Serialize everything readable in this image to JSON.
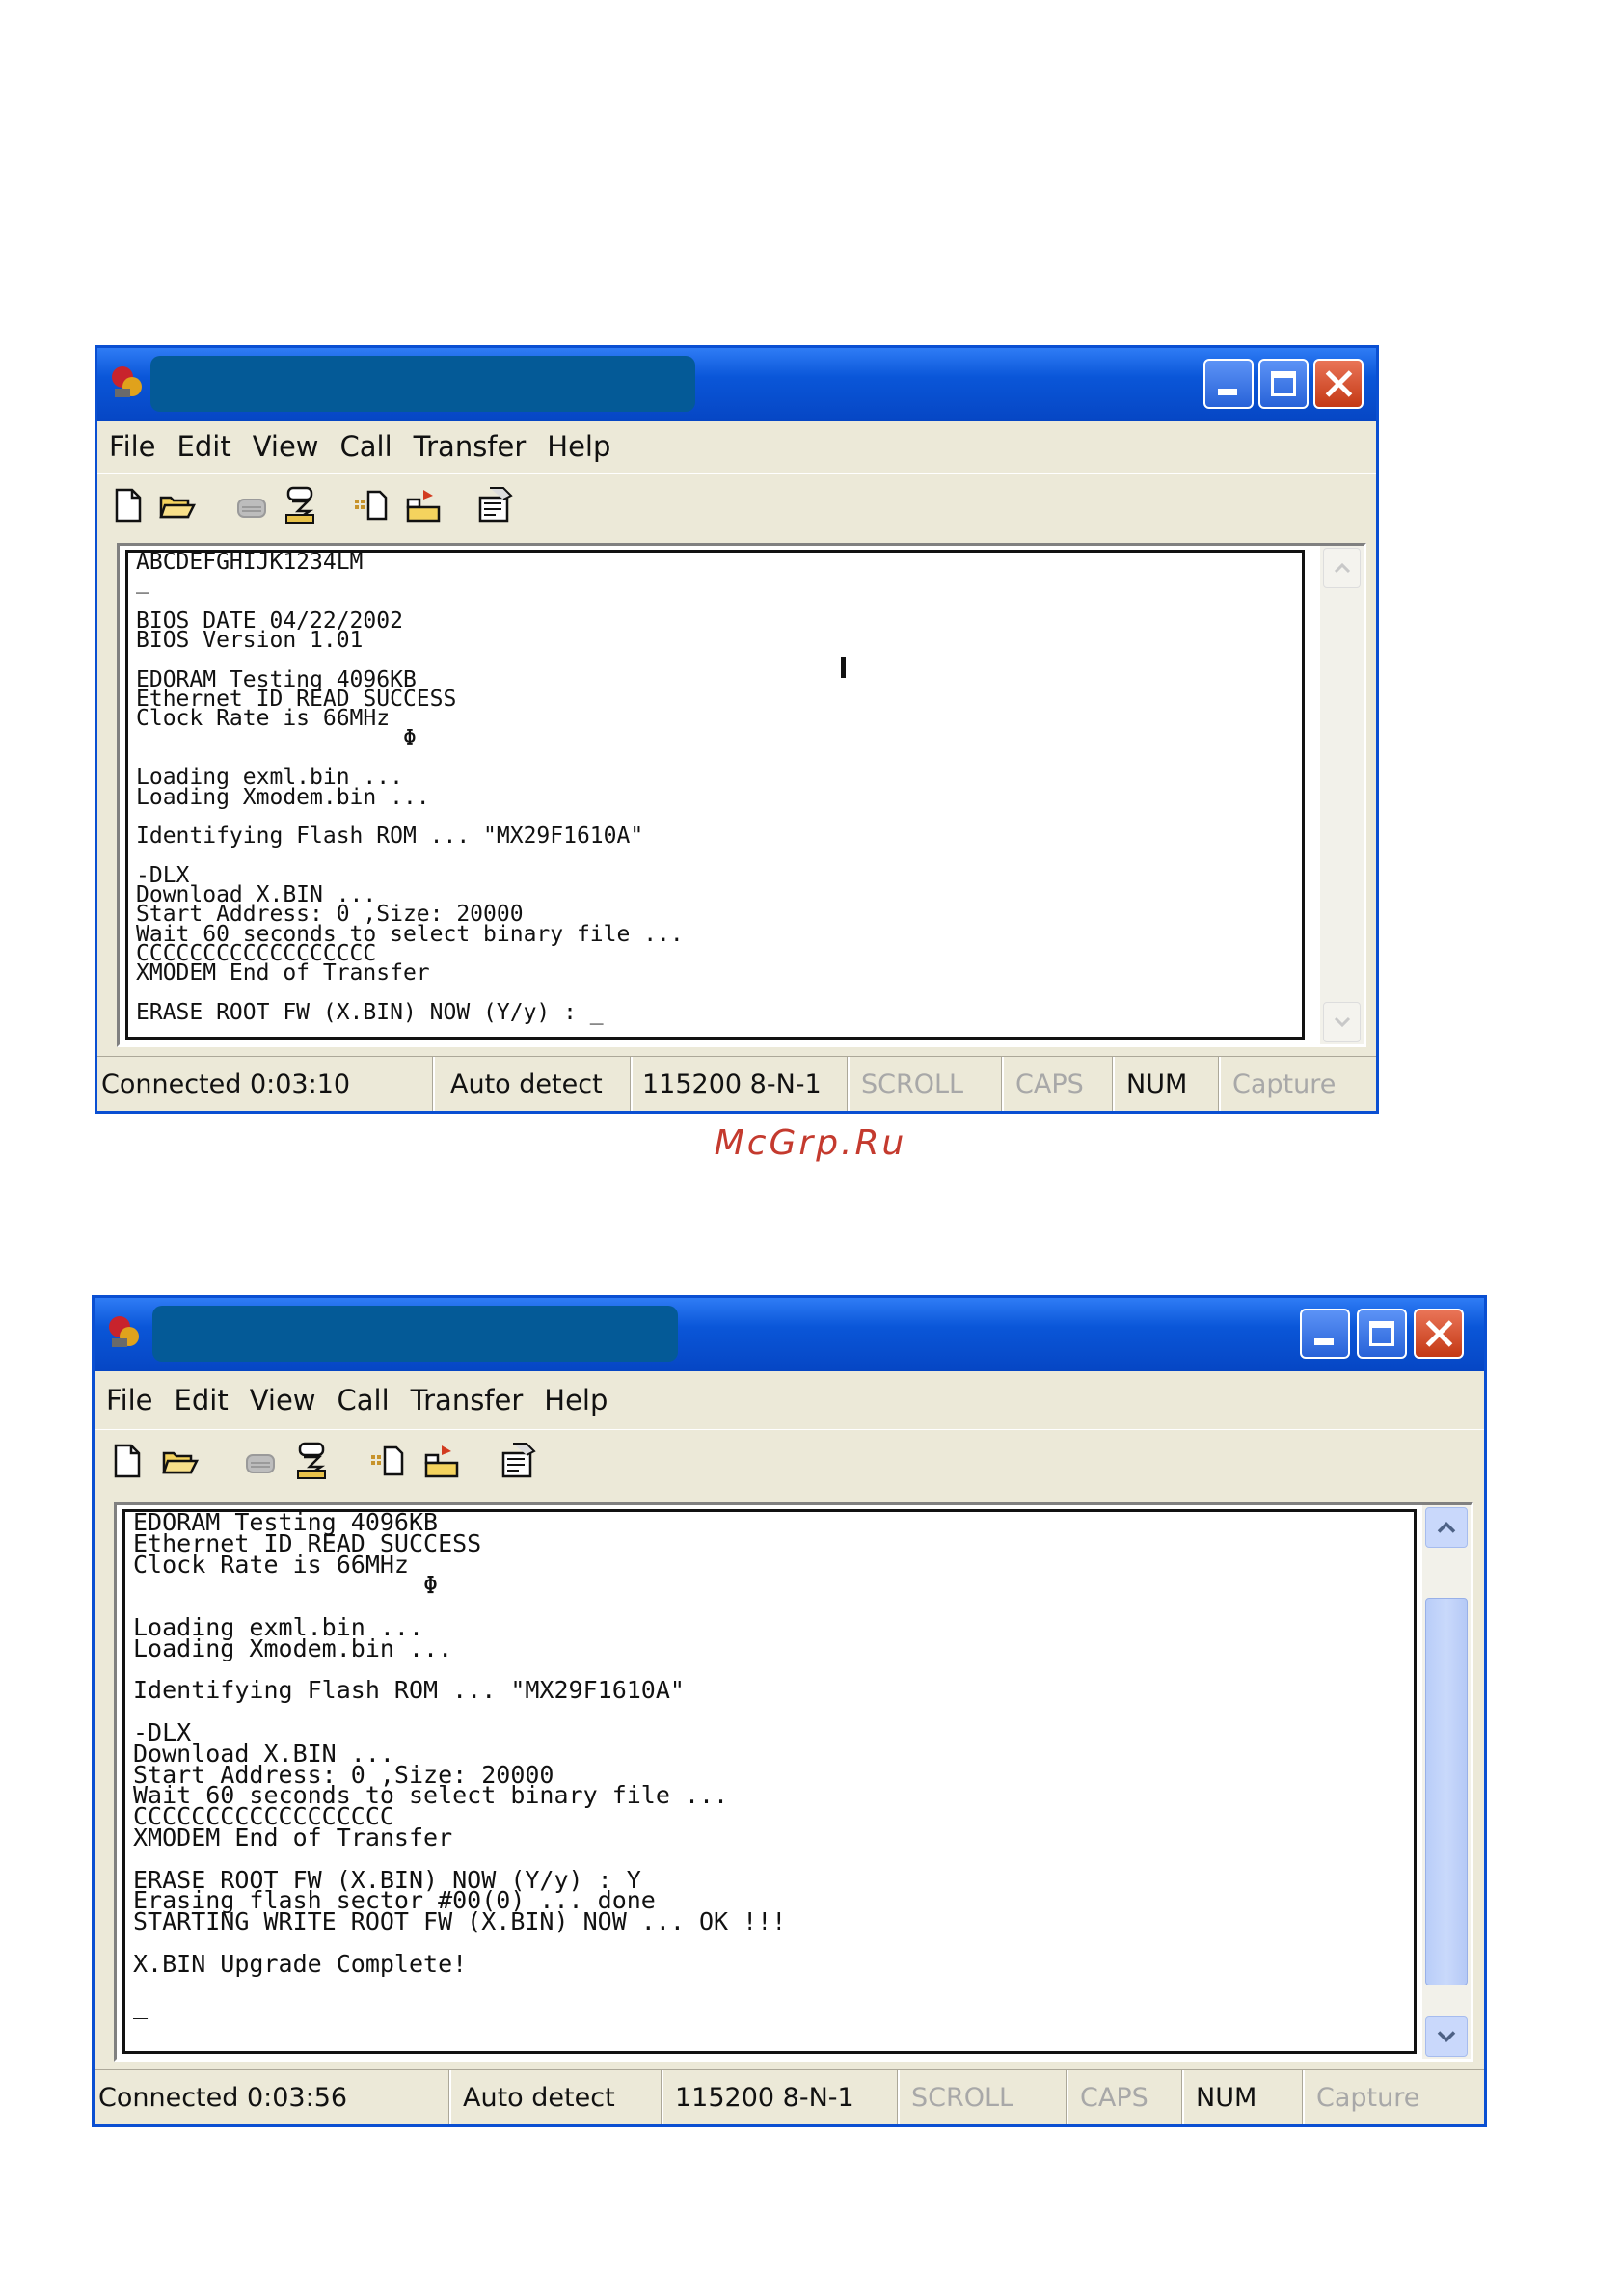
{
  "watermark": "McGrp.Ru",
  "windows": [
    {
      "menu": [
        "File",
        "Edit",
        "View",
        "Call",
        "Transfer",
        "Help"
      ],
      "toolbar_icons": [
        "new-document-icon",
        "open-folder-icon",
        "connect-phone-icon",
        "disconnect-phone-icon",
        "send-file-icon",
        "receive-file-icon",
        "properties-icon"
      ],
      "terminal_lines": "ABCDEFGHIJK1234LM\n_\n\nBIOS DATE 04/22/2002\nBIOS Version 1.01\n\nEDORAM Testing 4096KB\nEthernet ID READ SUCCESS\nClock Rate is 66MHz\n                    Φ\n\nLoading exml.bin ...\nLoading Xmodem.bin ...\n\nIdentifying Flash ROM ... \"MX29F1610A\"\n\n-DLX\nDownload X.BIN ...\nStart Address: 0 ,Size: 20000\nWait 60 seconds to select binary file ...\nCCCCCCCCCCCCCCCCCC\nXMODEM End of Transfer\n\nERASE ROOT FW (X.BIN) NOW (Y/y) : _",
      "status": {
        "connected": "Connected 0:03:10",
        "detect": "Auto detect",
        "port": "115200 8-N-1",
        "scroll": "SCROLL",
        "caps": "CAPS",
        "num": "NUM",
        "capture": "Capture"
      }
    },
    {
      "menu": [
        "File",
        "Edit",
        "View",
        "Call",
        "Transfer",
        "Help"
      ],
      "toolbar_icons": [
        "new-document-icon",
        "open-folder-icon",
        "connect-phone-icon",
        "disconnect-phone-icon",
        "send-file-icon",
        "receive-file-icon",
        "properties-icon"
      ],
      "terminal_lines": "EDORAM Testing 4096KB\nEthernet ID READ SUCCESS\nClock Rate is 66MHz\n                    Φ\n\nLoading exml.bin ...\nLoading Xmodem.bin ...\n\nIdentifying Flash ROM ... \"MX29F1610A\"\n\n-DLX\nDownload X.BIN ...\nStart Address: 0 ,Size: 20000\nWait 60 seconds to select binary file ...\nCCCCCCCCCCCCCCCCCC\nXMODEM End of Transfer\n\nERASE ROOT FW (X.BIN) NOW (Y/y) : Y\nErasing flash sector #00(0) ... done\nSTARTING WRITE ROOT FW (X.BIN) NOW ... OK !!!\n\nX.BIN Upgrade Complete!\n\n_",
      "scroll_position": 0.6,
      "status": {
        "connected": "Connected 0:03:56",
        "detect": "Auto detect",
        "port": "115200 8-N-1",
        "scroll": "SCROLL",
        "caps": "CAPS",
        "num": "NUM",
        "capture": "Capture"
      }
    }
  ]
}
